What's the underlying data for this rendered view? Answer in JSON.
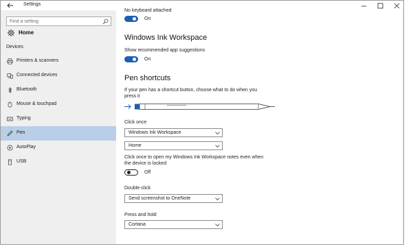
{
  "window": {
    "title": "Settings",
    "controls": [
      "minimize-icon",
      "maximize-icon",
      "close-icon"
    ]
  },
  "sidebar": {
    "search_placeholder": "Find a setting",
    "home_label": "Home",
    "section_label": "Devices",
    "items": [
      {
        "label": "Printers & scanners",
        "icon": "printer-icon"
      },
      {
        "label": "Connected devices",
        "icon": "connected-devices-icon"
      },
      {
        "label": "Bluetooth",
        "icon": "bluetooth-icon"
      },
      {
        "label": "Mouse & touchpad",
        "icon": "mouse-icon"
      },
      {
        "label": "Typing",
        "icon": "keyboard-icon"
      },
      {
        "label": "Pen",
        "icon": "pen-icon",
        "active": true
      },
      {
        "label": "AutoPlay",
        "icon": "autoplay-icon"
      },
      {
        "label": "USB",
        "icon": "usb-icon"
      }
    ]
  },
  "main": {
    "cut_off_label": "No keyboard attached",
    "toggle1_state": "On",
    "ink_heading": "Windows Ink Workspace",
    "suggestions_label": "Show recommended app suggestions",
    "toggle2_state": "On",
    "pen_heading": "Pen shortcuts",
    "pen_description_line1": "If your pen has a shortcut button, choose what to do when you",
    "pen_description_line2": "press it",
    "click_once_label": "Click once",
    "click_once_value": "Windows Ink Workspace",
    "click_once_sub_value": "Home",
    "locked_desc_line1": "Click once to open my Windows Ink Workspace notes even when",
    "locked_desc_line2": "the device is locked",
    "toggle3_state": "Off",
    "double_click_label": "Double-click",
    "double_click_value": "Send screenshot to OneNote",
    "press_hold_label": "Press and hold",
    "press_hold_value": "Cortana"
  },
  "colors": {
    "accent": "#1f5fb0",
    "sidebar_bg": "#efefef",
    "active_item_bg": "#b9cfe7"
  }
}
